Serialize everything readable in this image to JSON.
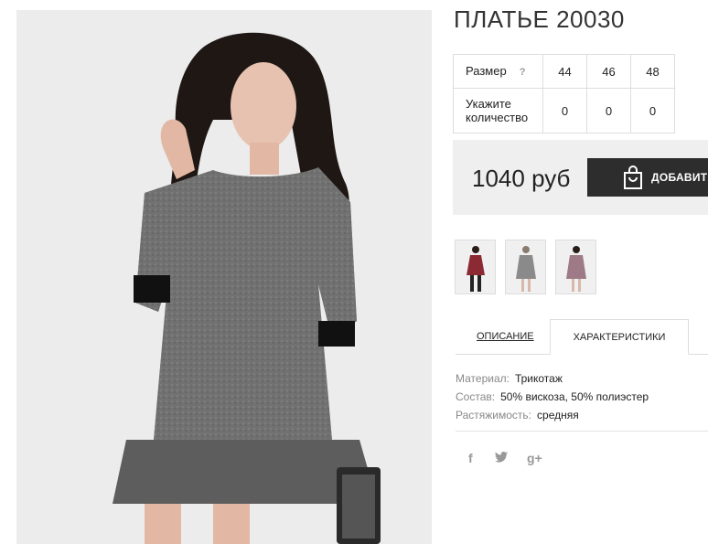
{
  "product": {
    "title": "ПЛАТЬЕ 20030",
    "main_image_alt": "dress-photo"
  },
  "sizes": {
    "size_label": "Размер",
    "help": "?",
    "quantity_label": "Укажите количество",
    "columns": [
      {
        "size": "44",
        "qty": "0"
      },
      {
        "size": "46",
        "qty": "0"
      },
      {
        "size": "48",
        "qty": "0"
      }
    ]
  },
  "price": {
    "value": "1040 руб",
    "add_button_label": "ДОБАВИТЬ"
  },
  "thumbnails": [
    {
      "name": "burgundy-dress",
      "color": "#8b2a33"
    },
    {
      "name": "gray-dress",
      "color": "#8a8a8a"
    },
    {
      "name": "pink-gray-dress",
      "color": "#9d7a85"
    }
  ],
  "tabs": {
    "description": "ОПИСАНИЕ",
    "characteristics": "ХАРАКТЕРИСТИКИ"
  },
  "specs": [
    {
      "key": "Материал:",
      "value": "Трикотаж"
    },
    {
      "key": "Состав:",
      "value": "50% вискоза, 50% полиэстер"
    },
    {
      "key": "Растяжимость:",
      "value": "средняя"
    }
  ],
  "social": {
    "facebook": "f",
    "twitter": "",
    "google_plus": "g+"
  },
  "colors": {
    "button_bg": "#2d2d2d",
    "price_bg": "#efefef",
    "border": "#dddddd"
  }
}
